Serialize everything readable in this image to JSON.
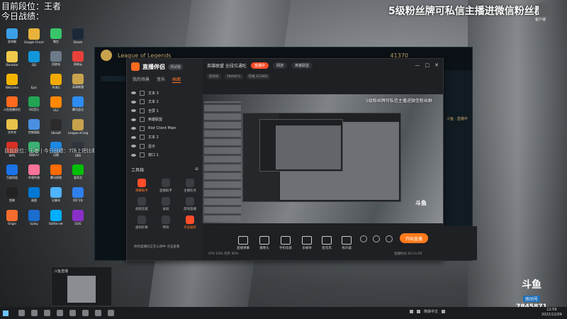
{
  "overlay": {
    "top_left_line1": "目前段位：王者",
    "top_left_line2": "今日战绩：",
    "top_right_banner": "5级粉丝牌可私信主播进微信粉丝群",
    "scroll_message": "目前段位：王者 | 今日战绩：7场上把比赛中你打死人了吧"
  },
  "desktop": {
    "icons": [
      "此电脑",
      "Google Chrome",
      "微信",
      "Steam",
      "Rockstar",
      "QQ",
      "回收站",
      "网易云",
      "WeGame",
      "Epic",
      "PUBG",
      "英雄联盟",
      "斗鱼直播伴侣",
      "QQ音乐",
      "VLC",
      "腾讯会议",
      "文件夹",
      "控制面板",
      "Ubisoft",
      "League of Legends",
      "WPS",
      "网易UU",
      "迅雷",
      "OBS",
      "百度网盘",
      "哔哩哔哩",
      "腾讯视频",
      "爱奇艺",
      "剪映",
      "画图",
      "记事本",
      "QQ飞车",
      "Origin",
      "Uplay",
      "Battle.net",
      "GOG"
    ],
    "right_icon_label": "客户端"
  },
  "game_client": {
    "title": "League of Legends",
    "rank_text": "41370",
    "side_text": "斗鱼 · 直播中"
  },
  "streaming_app": {
    "brand": "直播伴侣",
    "version": "测试版",
    "left_tabs": [
      "我的场景",
      "音乐",
      "画面"
    ],
    "layers": [
      "文本 3",
      "文本 2",
      "全屏 1",
      "英雄联盟",
      "Riot Client Main",
      "文本 2",
      "显示",
      "窗口 1"
    ],
    "tools_header": "工具箱",
    "tools": [
      {
        "label": "弹幕助手",
        "hot": true
      },
      {
        "label": "直播助手",
        "hot": false
      },
      {
        "label": "主播任务",
        "hot": false
      },
      {
        "label": "视频连麦",
        "hot": false
      },
      {
        "label": "录屏",
        "hot": false
      },
      {
        "label": "游戏直播",
        "hot": false
      },
      {
        "label": "虚拟形象",
        "hot": false
      },
      {
        "label": "特效",
        "hot": false
      },
      {
        "label": "幸运抽奖",
        "hot": true
      }
    ],
    "notice": "你的直播间正在公测中 点击查看",
    "room_title": "英雄联盟 全段位通吃",
    "live_pill": "直播中",
    "category_pill": "网游",
    "category_sub": "英雄联盟",
    "window_controls": [
      "—",
      "□",
      "✕"
    ],
    "room_row2": [
      "房间号",
      "7845871",
      "在线 413461"
    ],
    "preview_title": "5级粉丝牌可私信主播进微信粉丝群",
    "preview_watermark": "斗鱼",
    "controls": [
      "直播弹幕",
      "摄像头",
      "手机投屏",
      "多媒体",
      "麦克风",
      "扬声器"
    ],
    "go_live": "开始直播",
    "status_left": "CPU 23%  内存 45%",
    "status_right": "直播时长 02:11:05"
  },
  "thumb": {
    "title": "斗鱼直播"
  },
  "douyu_watermark": {
    "logo": "斗鱼",
    "sub": "房间号",
    "room": "7845871"
  },
  "taskbar": {
    "tray_text": "简体中文",
    "time": "12:59",
    "date": "2022/12/09"
  }
}
